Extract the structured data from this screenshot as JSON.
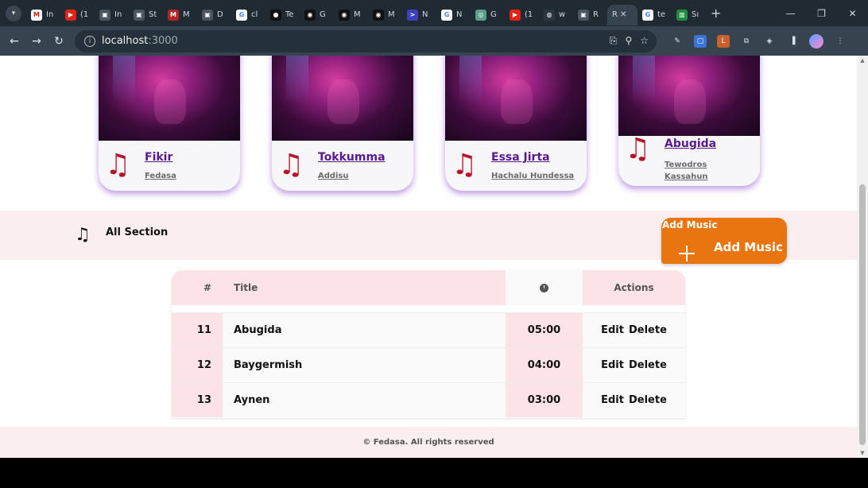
{
  "browser": {
    "tabs": [
      {
        "icon": "gmail-icon",
        "title": "In",
        "color": "#c5221f",
        "glyph": "M"
      },
      {
        "icon": "youtube-icon",
        "title": "(1",
        "color": "#e62117",
        "glyph": "▶"
      },
      {
        "icon": "page-icon",
        "title": "In",
        "color": "#4a5560",
        "glyph": "▣"
      },
      {
        "icon": "page-icon",
        "title": "St",
        "color": "#4a5560",
        "glyph": "▣"
      },
      {
        "icon": "medium-icon",
        "title": "M",
        "color": "#b2232a",
        "glyph": "M"
      },
      {
        "icon": "page-icon",
        "title": "D",
        "color": "#4a5560",
        "glyph": "▣"
      },
      {
        "icon": "google-icon",
        "title": "cl",
        "color": "#ffffff",
        "glyph": "G"
      },
      {
        "icon": "medium-icon",
        "title": "Te",
        "color": "#111111",
        "glyph": "●"
      },
      {
        "icon": "github-icon",
        "title": "G",
        "color": "#111111",
        "glyph": "◉"
      },
      {
        "icon": "github-icon",
        "title": "M",
        "color": "#111111",
        "glyph": "◉"
      },
      {
        "icon": "github-icon",
        "title": "M",
        "color": "#111111",
        "glyph": "◉"
      },
      {
        "icon": "terminal-icon",
        "title": "N",
        "color": "#3d3fbf",
        "glyph": ">"
      },
      {
        "icon": "google-icon",
        "title": "N",
        "color": "#ffffff",
        "glyph": "G"
      },
      {
        "icon": "chatgpt-icon",
        "title": "G",
        "color": "#5a9f8a",
        "glyph": "◎"
      },
      {
        "icon": "youtube-icon",
        "title": "(1",
        "color": "#e62117",
        "glyph": "▶"
      },
      {
        "icon": "globe-icon",
        "title": "w",
        "color": "#2b353e",
        "glyph": "◍"
      },
      {
        "icon": "page-icon",
        "title": "R",
        "color": "#4a5560",
        "glyph": "▣"
      }
    ],
    "active_tab": {
      "title": "R",
      "icon": "page-icon",
      "close": "✕"
    },
    "tabs_after": [
      {
        "icon": "google-icon",
        "title": "te",
        "color": "#ffffff",
        "glyph": "G"
      },
      {
        "icon": "chart-icon",
        "title": "Sı",
        "color": "#1e8e3e",
        "glyph": "▥"
      }
    ],
    "new_tab": "+",
    "url_host": "localhost",
    "url_port": ":3000"
  },
  "cards": [
    {
      "title": "Fikir",
      "artist": "Fedasa"
    },
    {
      "title": "Tokkumma",
      "artist": "Addisu"
    },
    {
      "title": "Essa Jirta",
      "artist": "Hachalu Hundessa"
    },
    {
      "title": "Abugida",
      "artist": "Tewodros Kassahun"
    }
  ],
  "section": {
    "title": "All Section",
    "add_button_small": "Add Music",
    "add_button_big": "Add Music"
  },
  "table": {
    "headers": {
      "num": "#",
      "title": "Title",
      "time_icon": "clock-icon",
      "actions": "Actions"
    },
    "rows": [
      {
        "num": "11",
        "title": "Abugida",
        "time": "05:00",
        "edit": "Edit",
        "delete": "Delete"
      },
      {
        "num": "12",
        "title": "Baygermish",
        "time": "04:00",
        "edit": "Edit",
        "delete": "Delete"
      },
      {
        "num": "13",
        "title": "Aynen",
        "time": "03:00",
        "edit": "Edit",
        "delete": "Delete"
      }
    ]
  },
  "footer": {
    "text": "© Fedasa. All rights reserved"
  },
  "colors": {
    "accent_orange": "#e8750f",
    "card_title_purple": "#5a1a8e",
    "music_note_red": "#b8152b",
    "band_pink": "#fbeef0"
  }
}
